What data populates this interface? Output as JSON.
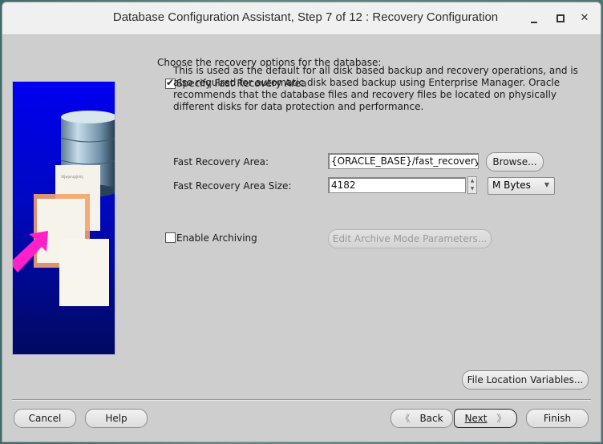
{
  "window": {
    "title": "Database Configuration Assistant, Step 7 of 12 : Recovery Configuration",
    "controls": {
      "minimize": "minimize",
      "maximize": "maximize",
      "close": "close"
    }
  },
  "main": {
    "heading": "Choose the recovery options for the database:",
    "fast_recovery": {
      "checkbox_label": "Specify Fast Recovery Area",
      "checked": true,
      "description": "This is used as the default for all disk based backup and recovery operations, and is also required for automatic disk based backup using Enterprise Manager. Oracle recommends that the database files and recovery files be located on physically different disks for data protection and performance.",
      "area_label": "Fast Recovery Area:",
      "area_value": "{ORACLE_BASE}/fast_recovery_a",
      "browse_label": "Browse...",
      "size_label": "Fast Recovery Area Size:",
      "size_value": "4182",
      "unit_selected": "M Bytes"
    },
    "archiving": {
      "checkbox_label": "Enable Archiving",
      "checked": false,
      "edit_params_label": "Edit Archive Mode Parameters..."
    },
    "file_location_label": "File Location Variables..."
  },
  "footer": {
    "cancel": "Cancel",
    "help": "Help",
    "back": "Back",
    "next": "Next",
    "finish": "Finish"
  },
  "illustration": {
    "description": "database cylinder with documents and arrow",
    "doc_text": "Vtjwjvnzyjkmj"
  }
}
